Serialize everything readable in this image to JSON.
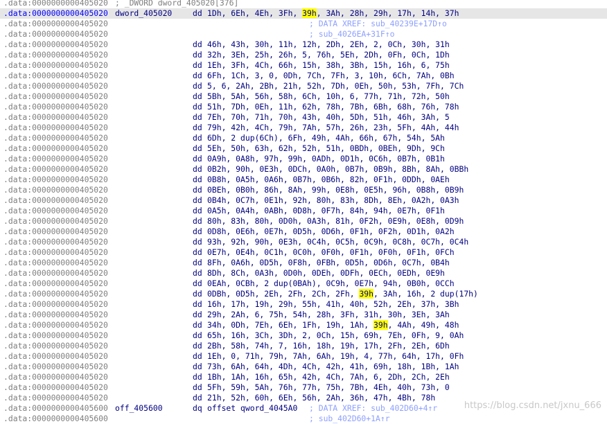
{
  "highlight": "39h",
  "watermark": "https://blog.csdn.net/jxnu_666",
  "lines": [
    {
      "addr": ".data:0000000000405020",
      "header": "; _DWORD dword_405020[376]"
    },
    {
      "addr": ".data:0000000000405020",
      "label": "dword_405020",
      "mnemonic": "dd",
      "operands": "1Dh, 6Eh, 4Eh, 3Fh, 39h, 3Ah, 28h, 29h, 17h, 14h, 37h",
      "current": true
    },
    {
      "addr": ".data:0000000000405020",
      "xref": "; DATA XREF: sub_40239E+17D↑o"
    },
    {
      "addr": ".data:0000000000405020",
      "xref": "; sub_4026EA+31F↑o"
    },
    {
      "addr": ".data:0000000000405020",
      "mnemonic": "dd",
      "operands": "46h, 43h, 30h, 11h, 12h, 2Dh, 2Eh, 2, 0Ch, 30h, 31h"
    },
    {
      "addr": ".data:0000000000405020",
      "mnemonic": "dd",
      "operands": "32h, 3Eh, 25h, 26h, 5, 76h, 5Eh, 2Dh, 0Fh, 0Ch, 1Dh"
    },
    {
      "addr": ".data:0000000000405020",
      "mnemonic": "dd",
      "operands": "1Eh, 3Fh, 4Ch, 66h, 15h, 38h, 3Bh, 15h, 16h, 6, 75h"
    },
    {
      "addr": ".data:0000000000405020",
      "mnemonic": "dd",
      "operands": "6Fh, 1Ch, 3, 0, 0Dh, 7Ch, 7Fh, 3, 10h, 6Ch, 7Ah, 0Bh"
    },
    {
      "addr": ".data:0000000000405020",
      "mnemonic": "dd",
      "operands": "5, 6, 2Ah, 2Bh, 21h, 52h, 7Dh, 0Eh, 50h, 53h, 7Fh, 7Ch"
    },
    {
      "addr": ".data:0000000000405020",
      "mnemonic": "dd",
      "operands": "5Bh, 5Ah, 56h, 58h, 6Ch, 10h, 6, 77h, 71h, 72h, 50h"
    },
    {
      "addr": ".data:0000000000405020",
      "mnemonic": "dd",
      "operands": "51h, 7Dh, 0Eh, 11h, 62h, 78h, 7Bh, 6Bh, 68h, 76h, 78h"
    },
    {
      "addr": ".data:0000000000405020",
      "mnemonic": "dd",
      "operands": "7Eh, 70h, 71h, 70h, 43h, 40h, 5Dh, 51h, 46h, 3Ah, 5"
    },
    {
      "addr": ".data:0000000000405020",
      "mnemonic": "dd",
      "operands": "79h, 42h, 4Ch, 79h, 7Ah, 57h, 26h, 23h, 5Fh, 4Ah, 44h"
    },
    {
      "addr": ".data:0000000000405020",
      "mnemonic": "dd",
      "operands": "6Dh, 2 dup(6Ch), 6Fh, 49h, 4Ah, 66h, 67h, 54h, 5Ah"
    },
    {
      "addr": ".data:0000000000405020",
      "mnemonic": "dd",
      "operands": "5Eh, 50h, 63h, 62h, 52h, 51h, 0BDh, 0BEh, 9Dh, 9Ch"
    },
    {
      "addr": ".data:0000000000405020",
      "mnemonic": "dd",
      "operands": "0A9h, 0A8h, 97h, 99h, 0ADh, 0D1h, 0C6h, 0B7h, 0B1h"
    },
    {
      "addr": ".data:0000000000405020",
      "mnemonic": "dd",
      "operands": "0B2h, 90h, 0E3h, 0DCh, 0A0h, 0B7h, 0B9h, 8Bh, 8Ah, 0BBh"
    },
    {
      "addr": ".data:0000000000405020",
      "mnemonic": "dd",
      "operands": "0B8h, 0A5h, 0A6h, 0B7h, 0B6h, 82h, 0F1h, 0DDh, 0AEh"
    },
    {
      "addr": ".data:0000000000405020",
      "mnemonic": "dd",
      "operands": "0BEh, 0B0h, 86h, 8Ah, 99h, 0E8h, 0E5h, 96h, 0B8h, 0B9h"
    },
    {
      "addr": ".data:0000000000405020",
      "mnemonic": "dd",
      "operands": "0B4h, 0C7h, 0E1h, 92h, 80h, 83h, 8Dh, 8Eh, 0A2h, 0A3h"
    },
    {
      "addr": ".data:0000000000405020",
      "mnemonic": "dd",
      "operands": "0A5h, 0A4h, 0ABh, 0D8h, 0F7h, 84h, 94h, 0E7h, 0F1h"
    },
    {
      "addr": ".data:0000000000405020",
      "mnemonic": "dd",
      "operands": "80h, 83h, 80h, 0D0h, 0A3h, 81h, 0F2h, 0E9h, 0E8h, 0D9h"
    },
    {
      "addr": ".data:0000000000405020",
      "mnemonic": "dd",
      "operands": "0D8h, 0E6h, 0E7h, 0D5h, 0D6h, 0F1h, 0F2h, 0D1h, 0A2h"
    },
    {
      "addr": ".data:0000000000405020",
      "mnemonic": "dd",
      "operands": "93h, 92h, 90h, 0E3h, 0C4h, 0C5h, 0C9h, 0C8h, 0C7h, 0C4h"
    },
    {
      "addr": ".data:0000000000405020",
      "mnemonic": "dd",
      "operands": "0E7h, 0E4h, 0C1h, 0C0h, 0F0h, 0F1h, 0F0h, 0F1h, 0FCh"
    },
    {
      "addr": ".data:0000000000405020",
      "mnemonic": "dd",
      "operands": "8Fh, 0A6h, 0D5h, 0F8h, 0FBh, 0D5h, 0D6h, 0C7h, 0B4h"
    },
    {
      "addr": ".data:0000000000405020",
      "mnemonic": "dd",
      "operands": "8Dh, 8Ch, 0A3h, 0D0h, 0DEh, 0DFh, 0ECh, 0EDh, 0E9h"
    },
    {
      "addr": ".data:0000000000405020",
      "mnemonic": "dd",
      "operands": "0EAh, 0CBh, 2 dup(0BAh), 0C9h, 0E7h, 94h, 0B0h, 0CCh"
    },
    {
      "addr": ".data:0000000000405020",
      "mnemonic": "dd",
      "operands": "0DBh, 0D5h, 2Eh, 2Fh, 2Ch, 2Fh, 39h, 3Ah, 16h, 2 dup(17h)"
    },
    {
      "addr": ".data:0000000000405020",
      "mnemonic": "dd",
      "operands": "16h, 17h, 19h, 29h, 55h, 41h, 40h, 52h, 2Eh, 37h, 3Bh"
    },
    {
      "addr": ".data:0000000000405020",
      "mnemonic": "dd",
      "operands": "29h, 2Ah, 6, 75h, 54h, 28h, 3Fh, 31h, 30h, 3Eh, 3Ah"
    },
    {
      "addr": ".data:0000000000405020",
      "mnemonic": "dd",
      "operands": "34h, 0Dh, 7Eh, 6Eh, 1Fh, 19h, 1Ah, 39h, 4Ah, 49h, 48h"
    },
    {
      "addr": ".data:0000000000405020",
      "mnemonic": "dd",
      "operands": "65h, 16h, 3Ch, 3Dh, 2, 0Ch, 15h, 69h, 7Eh, 0Fh, 9, 0Ah"
    },
    {
      "addr": ".data:0000000000405020",
      "mnemonic": "dd",
      "operands": "2Bh, 58h, 74h, 7, 16h, 18h, 19h, 17h, 2Fh, 2Eh, 6Dh"
    },
    {
      "addr": ".data:0000000000405020",
      "mnemonic": "dd",
      "operands": "1Eh, 0, 71h, 79h, 7Ah, 6Ah, 19h, 4, 77h, 64h, 17h, 0Fh"
    },
    {
      "addr": ".data:0000000000405020",
      "mnemonic": "dd",
      "operands": "73h, 6Ah, 64h, 4Dh, 4Ch, 42h, 41h, 69h, 18h, 1Bh, 1Ah"
    },
    {
      "addr": ".data:0000000000405020",
      "mnemonic": "dd",
      "operands": "1Bh, 1Ah, 16h, 65h, 42h, 4Ch, 7Ah, 6, 2Dh, 2Ch, 2Eh"
    },
    {
      "addr": ".data:0000000000405020",
      "mnemonic": "dd",
      "operands": "5Fh, 59h, 5Ah, 76h, 77h, 75h, 7Bh, 4Eh, 40h, 73h, 0"
    },
    {
      "addr": ".data:0000000000405020",
      "mnemonic": "dd",
      "operands": "21h, 52h, 60h, 6Eh, 56h, 2Ah, 36h, 47h, 4Bh, 78h"
    },
    {
      "addr": ".data:0000000000405600",
      "label": "off_405600",
      "mnemonic": "dq",
      "operands": "offset qword_4045A0",
      "xref": "; DATA XREF: sub_402D60+4↑r"
    },
    {
      "addr": ".data:0000000000405600",
      "xref": "; sub_402D60+1A↑r"
    }
  ]
}
